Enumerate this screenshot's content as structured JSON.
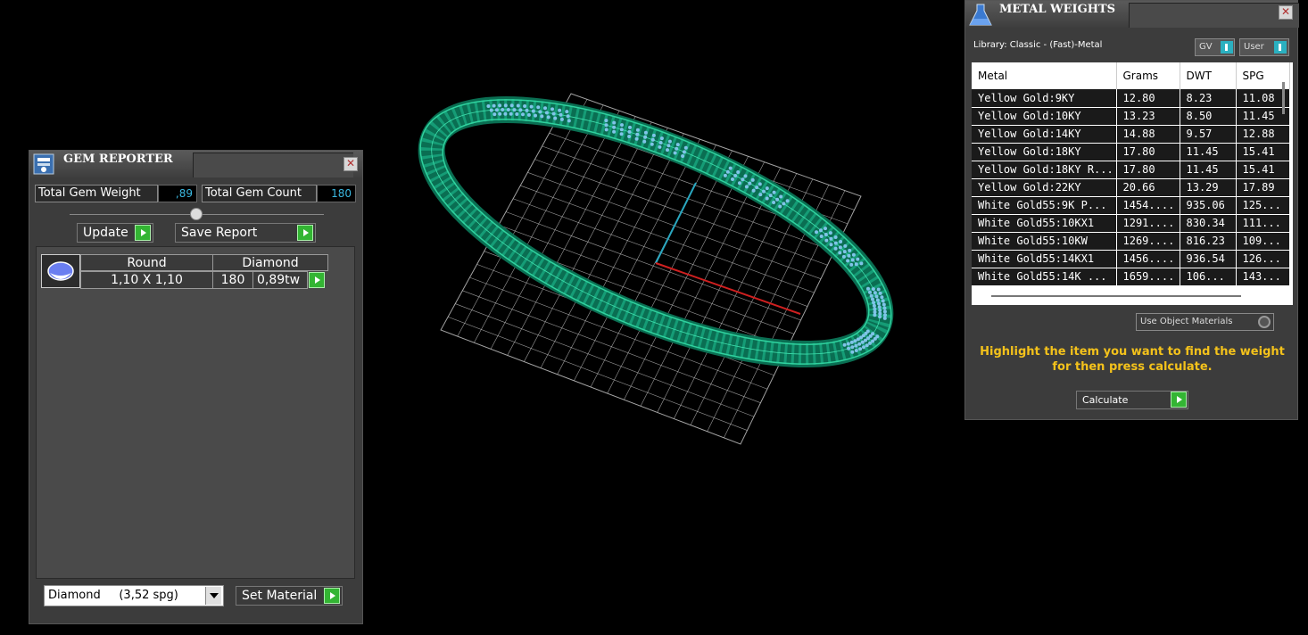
{
  "gem_reporter": {
    "title": "GEM REPORTER",
    "close": "✕",
    "total_weight_label": "Total Gem Weight",
    "total_weight_value": ",89",
    "total_count_label": "Total Gem Count",
    "total_count_value": "180",
    "update_label": "Update",
    "save_report_label": "Save Report",
    "gem": {
      "shape": "Round",
      "material": "Diamond",
      "size": "1,10 X 1,10",
      "count": "180",
      "weight": "0,89tw"
    },
    "material_select": "Diamond     (3,52 spg)",
    "set_material_label": "Set Material"
  },
  "metal_weights": {
    "title": "METAL WEIGHTS",
    "close": "✕",
    "library_label": "Library: Classic - (Fast)-Metal",
    "gv_label": "GV",
    "user_label": "User",
    "columns": [
      "Metal",
      "Grams",
      "DWT",
      "SPG"
    ],
    "rows": [
      [
        "Yellow Gold:9KY",
        "12.80",
        "8.23",
        "11.08"
      ],
      [
        "Yellow Gold:10KY",
        "13.23",
        "8.50",
        "11.45"
      ],
      [
        "Yellow Gold:14KY",
        "14.88",
        "9.57",
        "12.88"
      ],
      [
        "Yellow Gold:18KY",
        "17.80",
        "11.45",
        "15.41"
      ],
      [
        "Yellow Gold:18KY R...",
        "17.80",
        "11.45",
        "15.41"
      ],
      [
        "Yellow Gold:22KY",
        "20.66",
        "13.29",
        "17.89"
      ],
      [
        "White Gold55:9K P...",
        "1454....",
        "935.06",
        "125..."
      ],
      [
        "White Gold55:10KX1",
        "1291....",
        "830.34",
        "111..."
      ],
      [
        "White Gold55:10KW",
        "1269....",
        "816.23",
        "109..."
      ],
      [
        "White Gold55:14KX1",
        "1456....",
        "936.54",
        "126..."
      ],
      [
        "White Gold55:14K ...",
        "1659....",
        "106...",
        "143..."
      ]
    ],
    "use_object_materials_label": "Use Object Materials",
    "hint": "Highlight the item you want to find the weight for then press calculate.",
    "calculate_label": "Calculate"
  },
  "colors": {
    "ring": "#0e8a68",
    "stones": "#7fc4e8",
    "grid": "#cfcfcf",
    "axis_x": "#d02020",
    "axis_y": "#2aa7c0",
    "play_button": "#33b533",
    "hint": "#f4c21b"
  }
}
